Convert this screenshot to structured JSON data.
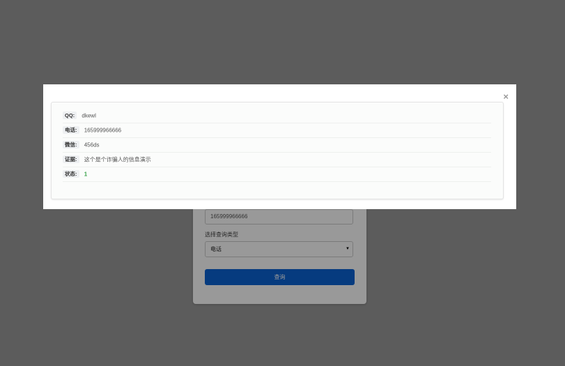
{
  "form": {
    "contact_value": "165999966666",
    "query_type_label": "选择查询类型",
    "query_type_selected": "电话",
    "submit_label": "查询"
  },
  "modal": {
    "close_glyph": "×",
    "rows": [
      {
        "label": "QQ:",
        "value": "dkewl"
      },
      {
        "label": "电话:",
        "value": "165999966666"
      },
      {
        "label": "微信:",
        "value": "456ds"
      },
      {
        "label": "证据:",
        "value": "这个是个诈骗人的信息演示"
      },
      {
        "label": "状态:",
        "value": "1"
      }
    ]
  },
  "colors": {
    "overlay": "#9a9a9a",
    "button": "#0a63d4",
    "status_value": "#3aa34a"
  }
}
